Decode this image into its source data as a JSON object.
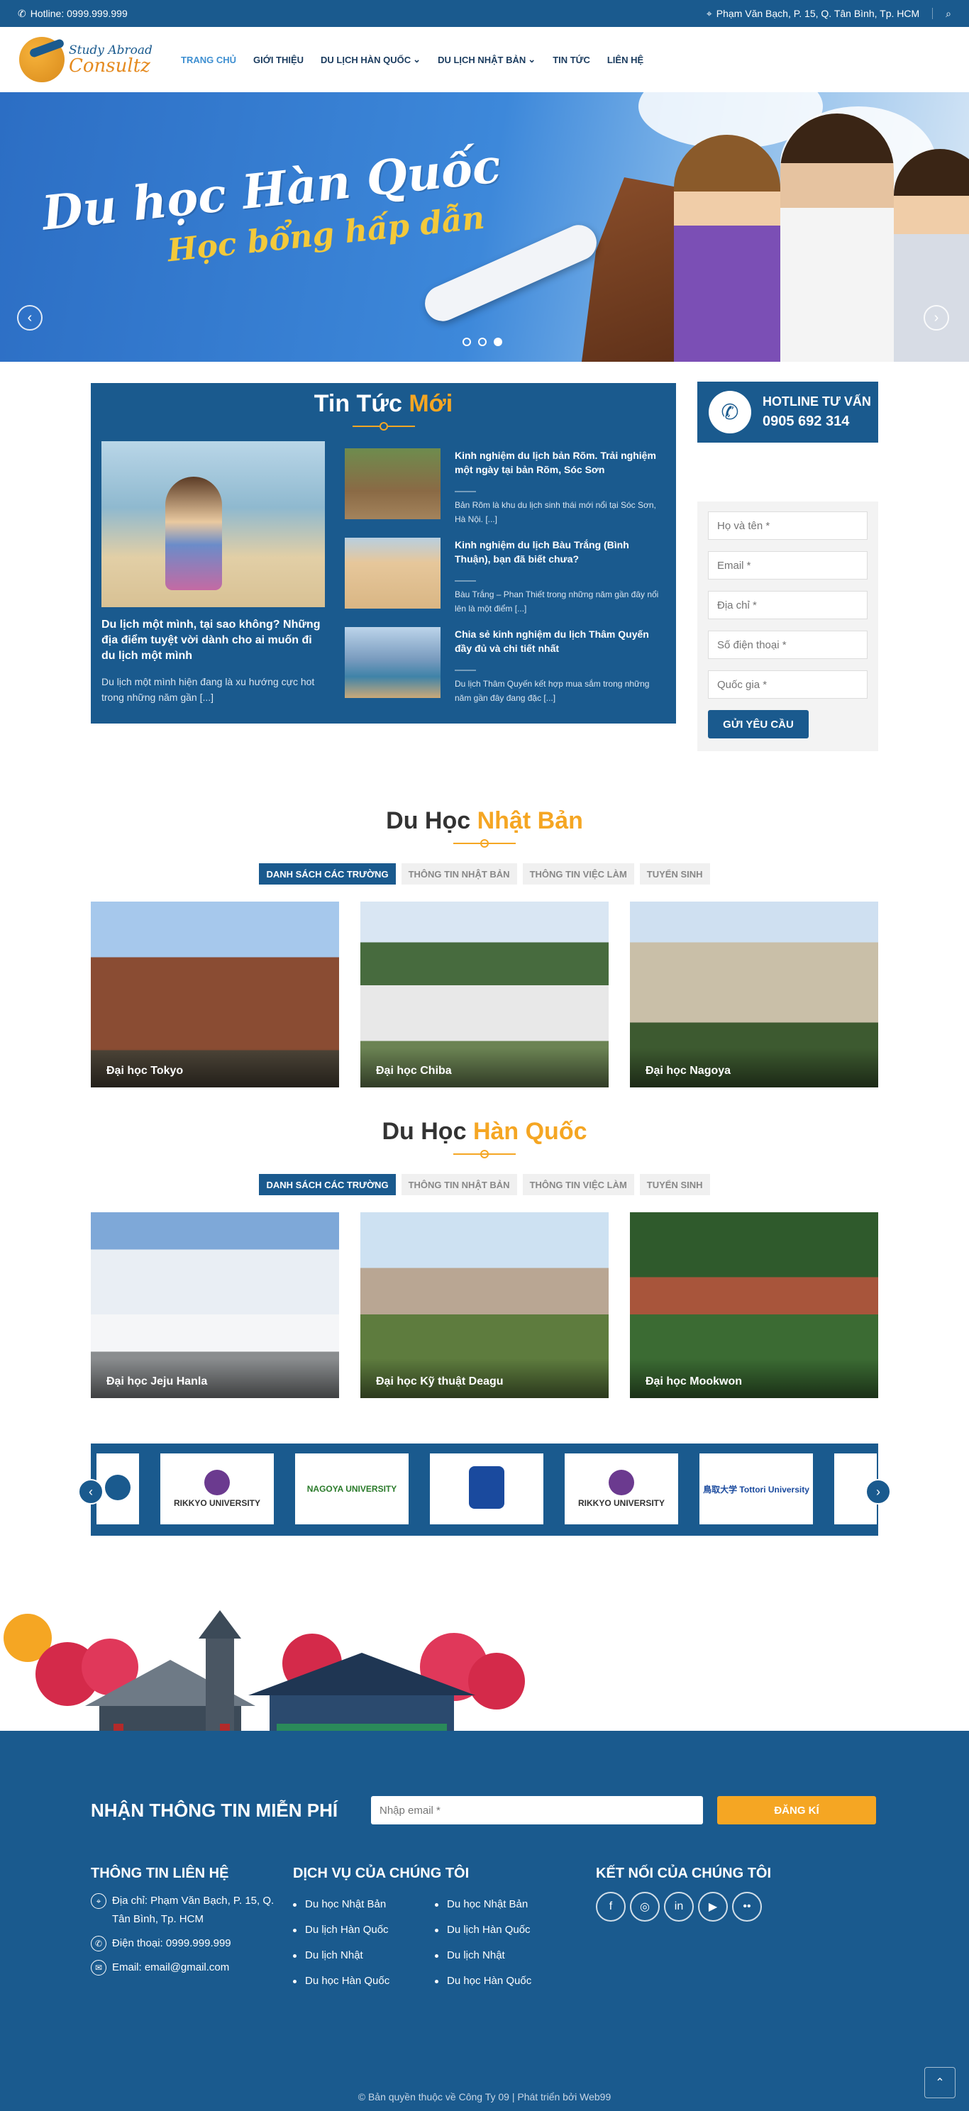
{
  "topbar": {
    "hotline": "Hotline: 0999.999.999",
    "address": "Phạm Văn Bạch, P. 15, Q. Tân Bình, Tp. HCM"
  },
  "logo": {
    "line1": "Study Abroad",
    "line2": "Consultz"
  },
  "nav": [
    {
      "label": "Trang chủ",
      "active": true
    },
    {
      "label": "Giới thiệu"
    },
    {
      "label": "Du lịch Hàn Quốc",
      "dropdown": true
    },
    {
      "label": "Du lịch Nhật Bản",
      "dropdown": true
    },
    {
      "label": "Tin tức"
    },
    {
      "label": "Liên hệ"
    }
  ],
  "hero": {
    "title": "Du học Hàn Quốc",
    "subtitle": "Học bổng hấp dẫn"
  },
  "news": {
    "title": "Tin Tức",
    "title_hl": "Mới",
    "featured": {
      "title": "Du lịch một mình, tại sao không? Những địa điểm tuyệt vời dành cho ai muốn đi du lịch một mình",
      "excerpt": "Du lịch một mình hiện đang là xu hướng cực hot trong những năm gần [...]"
    },
    "items": [
      {
        "title": "Kinh nghiệm du lịch bản Rõm. Trải nghiệm một ngày tại bản Rõm, Sóc Sơn",
        "excerpt": "Bản Rõm là khu du lịch sinh thái mới nổi tại Sóc Sơn, Hà Nội. [...]"
      },
      {
        "title": "Kinh nghiệm du lịch Bàu Trắng (Bình Thuận), bạn đã biết chưa?",
        "excerpt": "Bàu Trắng – Phan Thiết trong những năm gần đây nổi lên là một điểm [...]"
      },
      {
        "title": "Chia sẻ kinh nghiệm du lịch Thâm Quyến đầy đủ và chi tiết nhất",
        "excerpt": "Du lịch Thâm Quyến kết hợp mua sắm trong những năm gần đây đang đặc [...]"
      }
    ]
  },
  "hotline": {
    "label": "HOTLINE TƯ VẤN",
    "number": "0905 692 314"
  },
  "form": {
    "name": "Họ và tên *",
    "email": "Email *",
    "address": "Địa chỉ *",
    "phone": "Số điện thoại *",
    "country": "Quốc gia *",
    "submit": "GỬI YÊU CẦU"
  },
  "tabs": [
    "DANH SÁCH CÁC TRƯỜNG",
    "THÔNG TIN NHẬT BẢN",
    "THÔNG TIN VIỆC LÀM",
    "TUYỂN SINH"
  ],
  "japan": {
    "title": "Du Học",
    "title_hl": "Nhật Bản",
    "cards": [
      "Đại học Tokyo",
      "Đại học Chiba",
      "Đại học Nagoya"
    ]
  },
  "korea": {
    "title": "Du Học",
    "title_hl": "Hàn Quốc",
    "cards": [
      "Đại học Jeju Hanla",
      "Đại học Kỹ thuật Deagu",
      "Đại học Mookwon"
    ]
  },
  "partners": [
    "RIKKYO UNIVERSITY",
    "NAGOYA UNIVERSITY",
    "",
    "RIKKYO UNIVERSITY",
    "鳥取大学 Tottori University"
  ],
  "footer": {
    "newsletter_title": "NHẬN THÔNG TIN MIỄN PHÍ",
    "newsletter_placeholder": "Nhập email *",
    "newsletter_button": "ĐĂNG KÍ",
    "contact_title": "THÔNG TIN LIÊN HỆ",
    "contact_address": "Địa chỉ: Phạm Văn Bạch, P. 15, Q. Tân Bình, Tp. HCM",
    "contact_phone": "Điện thoại: 0999.999.999",
    "contact_email": "Email: email@gmail.com",
    "services_title": "DỊCH VỤ CỦA CHÚNG TÔI",
    "services_left": [
      "Du học Nhật Bản",
      "Du lịch Hàn Quốc",
      "Du lịch Nhật",
      "Du học Hàn Quốc"
    ],
    "services_right": [
      "Du học Nhật Bản",
      "Du lịch Hàn Quốc",
      "Du lịch Nhật",
      "Du học Hàn Quốc"
    ],
    "social_title": "KẾT NỐI CỦA CHÚNG TÔI",
    "copyright": "© Bản quyền thuộc về Công Ty 09 | Phát triển bởi Web99"
  }
}
